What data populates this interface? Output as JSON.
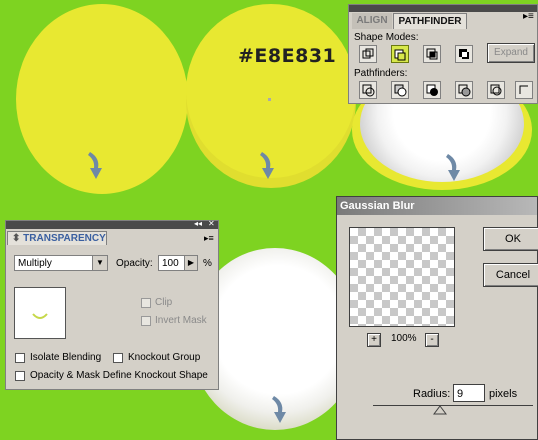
{
  "canvas": {
    "hex_label": "#E8E831",
    "colors": {
      "background": "#7ED321",
      "circle": "#E8E831",
      "arrow": "#6E89A6"
    }
  },
  "pathfinder": {
    "tabs": [
      "ALIGN",
      "PATHFINDER"
    ],
    "active_tab": "PATHFINDER",
    "shape_modes_label": "Shape Modes:",
    "expand_label": "Expand",
    "pathfinders_label": "Pathfinders:",
    "shape_mode_icons": [
      "unite-icon",
      "minus-front-icon",
      "intersect-icon",
      "exclude-icon"
    ],
    "pathfinder_icons": [
      "divide-icon",
      "trim-icon",
      "merge-icon",
      "crop-icon",
      "outline-icon",
      "minus-back-icon"
    ]
  },
  "transparency": {
    "title": "TRANSPARENCY",
    "blend_mode": "Multiply",
    "opacity_label": "Opacity:",
    "opacity_value": "100",
    "percent_sign": "%",
    "clip_label": "Clip",
    "invert_mask_label": "Invert Mask",
    "isolate_label": "Isolate Blending",
    "knockout_label": "Knockout Group",
    "opacity_mask_label": "Opacity & Mask Define Knockout Shape"
  },
  "gaussian": {
    "title": "Gaussian Blur",
    "ok_label": "OK",
    "cancel_label": "Cancel",
    "zoom_plus": "+",
    "zoom_value": "100%",
    "zoom_minus": "-",
    "radius_label": "Radius:",
    "radius_value": "9",
    "units_label": "pixels"
  }
}
